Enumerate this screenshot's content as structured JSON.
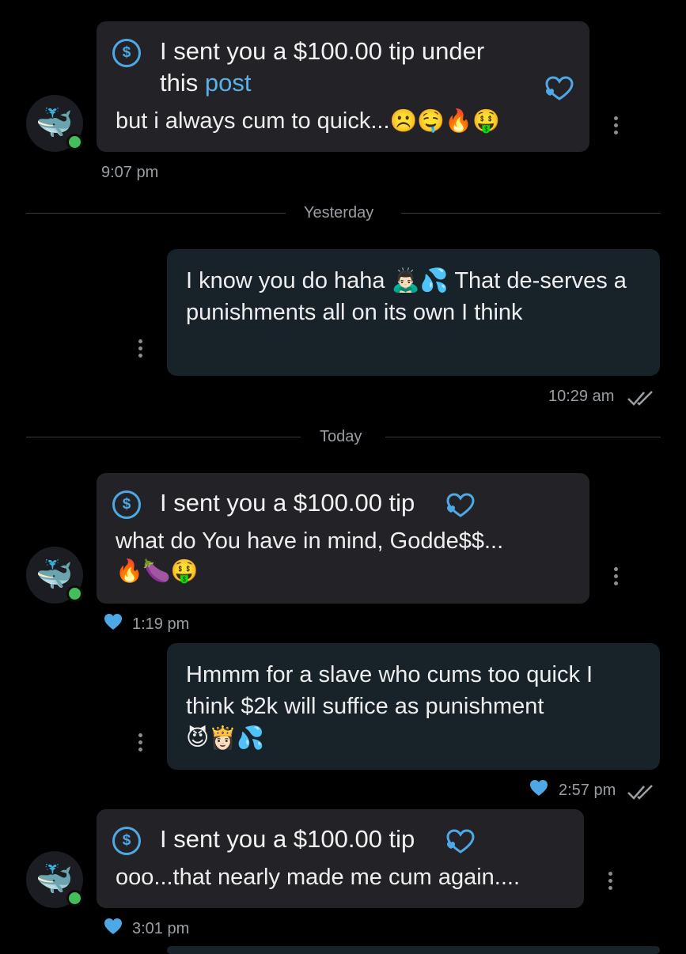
{
  "messages": [
    {
      "tip_text": "I sent you a $100.00 tip under",
      "tip_text_line2": "this",
      "tip_link": "post",
      "body": "but i always cum to quick...",
      "emojis": "☹️🤤🔥🤑",
      "time": "9:07 pm"
    },
    {
      "body": "I know you do haha 🙇🏻‍♂️💦 That de-serves a punishments all on its own I think",
      "time": "10:29 am"
    },
    {
      "tip_text": "I sent you a $100.00 tip",
      "body": "what do You have in mind, Godde$$...",
      "emojis": "🔥🍆🤑",
      "time": "1:19 pm"
    },
    {
      "body": "Hmmm for a slave who cums too quick I think $2k will suffice as punishment",
      "emojis": "😈👸🏻💦",
      "time": "2:57 pm"
    },
    {
      "tip_text": "I sent you a $100.00 tip",
      "body": "ooo...that nearly made me cum again....",
      "time": "3:01 pm"
    }
  ],
  "dividers": {
    "yesterday": "Yesterday",
    "today": "Today"
  },
  "icons": {
    "dollar": "$",
    "avatar": "🐳"
  },
  "colors": {
    "background": "#000000",
    "incoming_bubble": "#232327",
    "outgoing_bubble": "#182329",
    "accent": "#4ea8e6",
    "online": "#44bd5a"
  }
}
